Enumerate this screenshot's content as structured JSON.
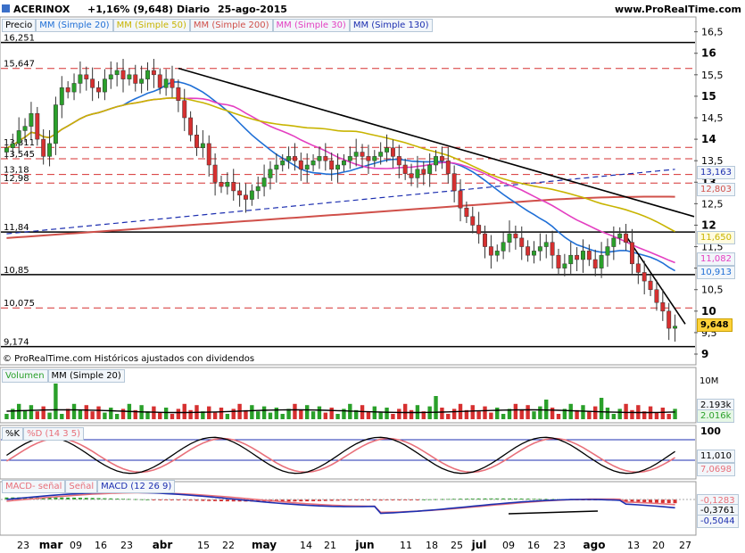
{
  "header": {
    "ticker": "ACERINOX",
    "change": "+1,16% (9,648)",
    "period": "Diario",
    "date": "25-ago-2015",
    "site": "www.ProRealTime.com"
  },
  "price_panel": {
    "title": "Precio",
    "legend": [
      {
        "label": "MM (Simple 20)",
        "color": "#1f6fd6"
      },
      {
        "label": "MM (Simple 50)",
        "color": "#c8b400"
      },
      {
        "label": "MM (Simple 200)",
        "color": "#d0504a"
      },
      {
        "label": "MM (Simple 30)",
        "color": "#e43fc1"
      },
      {
        "label": "MM (Simple 130)",
        "color": "#1d2fb0"
      }
    ],
    "copyright": "© ProRealTime.com  Históricos ajustados con dividendos",
    "left_levels": [
      "16,251",
      "15,647",
      "13,811",
      "13,545",
      "13,18",
      "12,98",
      "11,84",
      "10,85",
      "10,075",
      "9,174"
    ],
    "last_values": [
      {
        "label": "13,163",
        "color": "#1d2fb0"
      },
      {
        "label": "12,803",
        "color": "#d0504a"
      },
      {
        "label": "11,650",
        "color": "#c8b400"
      },
      {
        "label": "11,082",
        "color": "#e43fc1"
      },
      {
        "label": "10,913",
        "color": "#1f6fd6"
      },
      {
        "label": "9,648",
        "color": "#000000"
      }
    ]
  },
  "volume_panel": {
    "legend": [
      {
        "label": "Volumen",
        "color": "#2aa02a"
      },
      {
        "label": "MM (Simple 20)",
        "color": "#000000"
      }
    ],
    "axis": [
      "10M",
      "2.193k",
      "2.016k"
    ]
  },
  "stoch_panel": {
    "legend": [
      {
        "label": "%K",
        "color": "#000000"
      },
      {
        "label": "%D (14 3 5)",
        "color": "#e8707a"
      }
    ],
    "axis": [
      "100",
      "11,010",
      "7,0698"
    ]
  },
  "macd_panel": {
    "legend": [
      {
        "label": "MACD-  señal",
        "color": "#e8707a"
      },
      {
        "label": "Señal",
        "color": "#e8707a"
      },
      {
        "label": "MACD (12 26 9)",
        "color": "#1d2fb0"
      }
    ],
    "axis": [
      "-0,1283",
      "-0,3761",
      "-0,5044"
    ]
  },
  "x_axis": [
    "23",
    "mar",
    "09",
    "16",
    "23",
    "abr",
    "15",
    "22",
    "may",
    "14",
    "21",
    "jun",
    "11",
    "18",
    "25",
    "jul",
    "09",
    "16",
    "23",
    "ago",
    "13",
    "20",
    "27"
  ],
  "chart_data": {
    "type": "candlestick",
    "symbol": "ACERINOX",
    "interval": "Diario",
    "date_range": [
      "2015-02-23",
      "2015-08-25"
    ],
    "ylim": [
      9,
      16.7
    ],
    "y_ticks": [
      9,
      9.5,
      10,
      10.5,
      11,
      11.5,
      12,
      12.5,
      13,
      13.5,
      14,
      14.5,
      15,
      15.5,
      16,
      16.5
    ],
    "last_close": 9.648,
    "last_change_pct": 1.16,
    "horizontal_levels": [
      16.251,
      15.647,
      13.811,
      13.545,
      13.18,
      12.98,
      11.84,
      10.85,
      10.075,
      9.174
    ],
    "closes": [
      13.8,
      13.9,
      14.2,
      14.3,
      14.6,
      14.0,
      13.6,
      13.9,
      14.8,
      15.2,
      15.1,
      15.3,
      15.5,
      15.4,
      15.2,
      15.1,
      15.4,
      15.5,
      15.6,
      15.4,
      15.5,
      15.3,
      15.4,
      15.6,
      15.5,
      15.2,
      15.4,
      15.2,
      14.9,
      14.5,
      14.1,
      13.8,
      13.9,
      13.4,
      13.0,
      12.9,
      13.0,
      12.8,
      12.7,
      12.6,
      12.8,
      12.9,
      13.1,
      13.3,
      13.4,
      13.5,
      13.6,
      13.5,
      13.3,
      13.4,
      13.5,
      13.6,
      13.5,
      13.3,
      13.4,
      13.5,
      13.6,
      13.7,
      13.6,
      13.5,
      13.6,
      13.7,
      13.8,
      13.6,
      13.4,
      13.2,
      13.1,
      13.3,
      13.2,
      13.4,
      13.6,
      13.5,
      13.2,
      12.8,
      12.4,
      12.2,
      12.0,
      11.8,
      11.5,
      11.3,
      11.4,
      11.6,
      11.8,
      11.7,
      11.5,
      11.3,
      11.4,
      11.5,
      11.6,
      11.3,
      11.0,
      11.1,
      11.3,
      11.2,
      11.4,
      11.2,
      11.0,
      11.3,
      11.5,
      11.7,
      11.8,
      11.6,
      11.1,
      10.9,
      10.7,
      10.5,
      10.2,
      10.0,
      9.6,
      9.65
    ],
    "sma20_end": 10.913,
    "sma30_end": 11.082,
    "sma50_end": 11.65,
    "sma130_end": 13.163,
    "sma200_end": 12.803
  }
}
